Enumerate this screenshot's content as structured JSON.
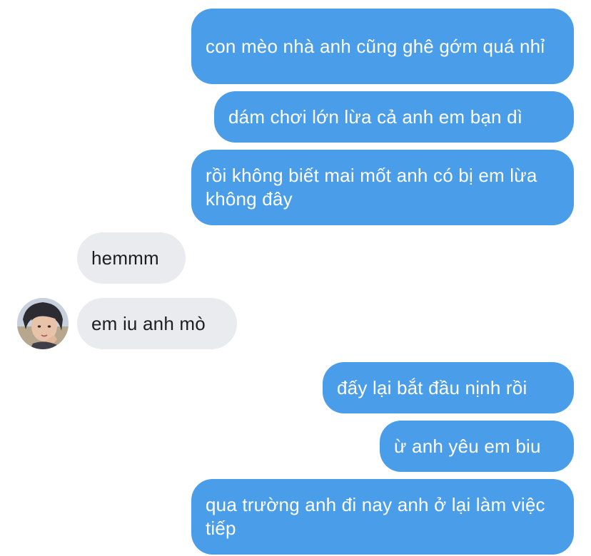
{
  "messages": [
    {
      "sender": "me",
      "text": "con mèo nhà anh cũng ghê gớm quá nhỉ"
    },
    {
      "sender": "me",
      "text": "dám chơi lớn lừa cả anh em bạn dì"
    },
    {
      "sender": "me",
      "text": "rồi không biết mai mốt anh có bị em lừa không đây"
    },
    {
      "sender": "them",
      "text": "hemmm"
    },
    {
      "sender": "them",
      "text": "em iu anh mò"
    },
    {
      "sender": "me",
      "text": "đấy lại bắt đầu nịnh rồi"
    },
    {
      "sender": "me",
      "text": "ừ anh yêu em biu"
    },
    {
      "sender": "me",
      "text": "qua trường anh đi nay anh ở lại làm việc tiếp"
    }
  ],
  "colors": {
    "outgoing_bubble": "#4a9de8",
    "incoming_bubble": "#e9ebef",
    "outgoing_text": "#ffffff",
    "incoming_text": "#1c1e21"
  },
  "icons": {
    "contact_avatar": "avatar-photo"
  }
}
